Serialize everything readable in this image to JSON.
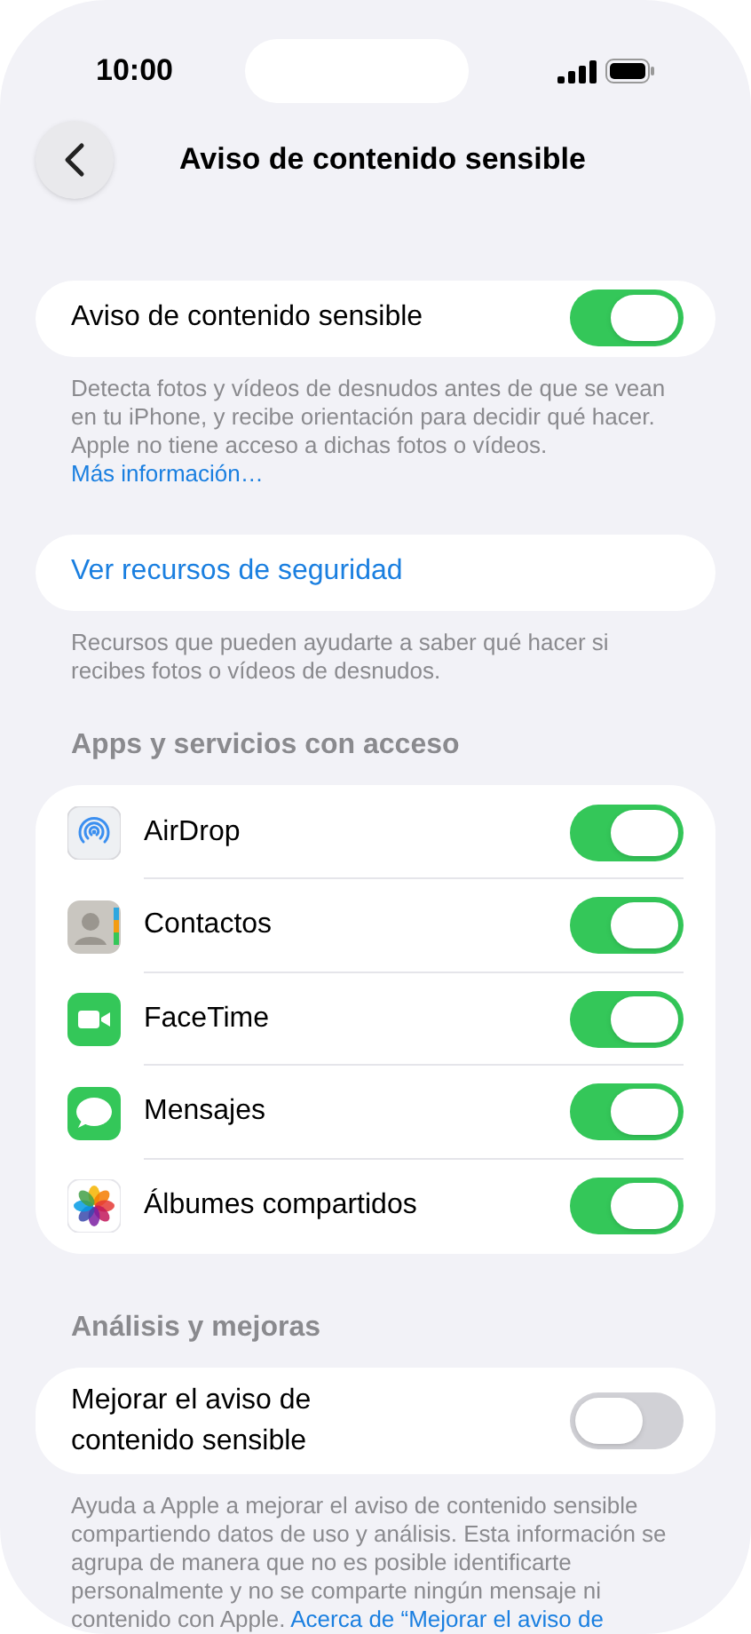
{
  "status_bar": {
    "time": "10:00"
  },
  "nav": {
    "title": "Aviso de contenido sensible"
  },
  "main_toggle": {
    "label": "Aviso de contenido sensible",
    "on": true,
    "footer": "Detecta fotos y vídeos de desnudos antes de que se vean en tu iPhone, y recibe orientación para decidir qué hacer. Apple no tiene acceso a dichas fotos o vídeos.",
    "footer_link": "Más información…"
  },
  "resources": {
    "label": "Ver recursos de seguridad",
    "footer": "Recursos que pueden ayudarte a saber qué hacer si recibes fotos o vídeos de desnudos."
  },
  "apps": {
    "header": "Apps y servicios con acceso",
    "items": [
      {
        "kind": "airdrop",
        "label": "AirDrop",
        "on": true
      },
      {
        "kind": "contacts",
        "label": "Contactos",
        "on": true
      },
      {
        "kind": "facetime",
        "label": "FaceTime",
        "on": true
      },
      {
        "kind": "messages",
        "label": "Mensajes",
        "on": true
      },
      {
        "kind": "photos",
        "label": "Álbumes compartidos",
        "on": true
      }
    ]
  },
  "analytics": {
    "header": "Análisis y mejoras",
    "label": "Mejorar el aviso de contenido sensible",
    "on": false,
    "footer": "Ayuda a Apple a mejorar el aviso de contenido sensible compartiendo datos de uso y análisis. Esta información se agrupa de manera que no es posible identificarte personalmente y no se comparte ningún mensaje ni contenido con Apple.",
    "footer_link": "Acerca de “Mejorar el aviso de"
  }
}
